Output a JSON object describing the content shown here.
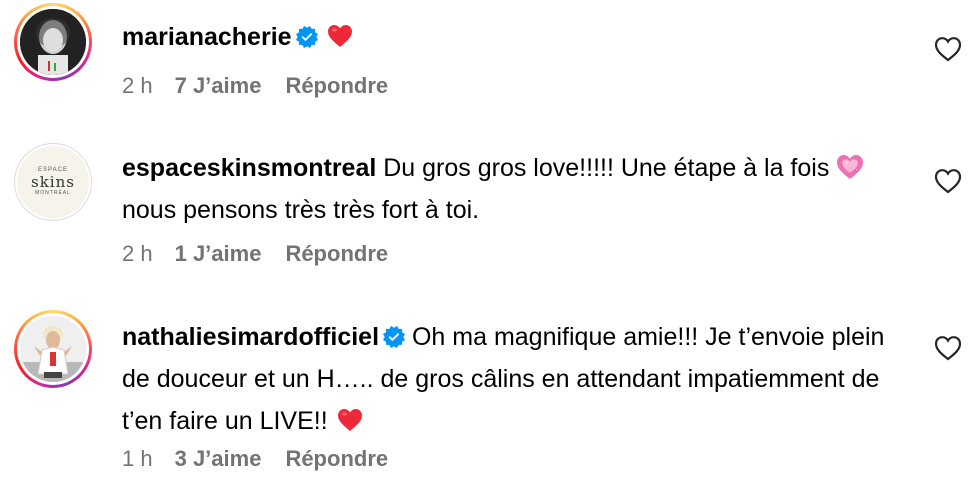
{
  "comments": [
    {
      "username": "marianacherie",
      "verified": true,
      "text": "",
      "emoji": "red-heart",
      "time": "2 h",
      "likes": "7 J’aime",
      "reply": "Répondre"
    },
    {
      "username": "espaceskinsmontreal",
      "verified": false,
      "avatar_text": "skins",
      "avatar_small_top": "ESPACE",
      "avatar_small_bottom": "MONTRÉAL",
      "text_part1": "Du gros gros love!!!!! Une étape à la fois ",
      "text_part2": "nous pensons très très fort à toi.",
      "time": "2 h",
      "likes": "1 J’aime",
      "reply": "Répondre"
    },
    {
      "username": "nathaliesimardofficiel",
      "verified": true,
      "text": "Oh ma magnifique amie!!! Je t’envoie plein de douceur et un H….. de gros câlins en attendant impatiemment de t’en faire un LIVE!! ",
      "emoji": "red-heart",
      "time": "1 h",
      "likes": "3 J’aime",
      "reply": "Répondre"
    }
  ],
  "colors": {
    "verified_blue": "#0095f6",
    "meta_gray": "#737373",
    "heart_red": "#ed2939",
    "pink_heart": "#f06fb1"
  }
}
